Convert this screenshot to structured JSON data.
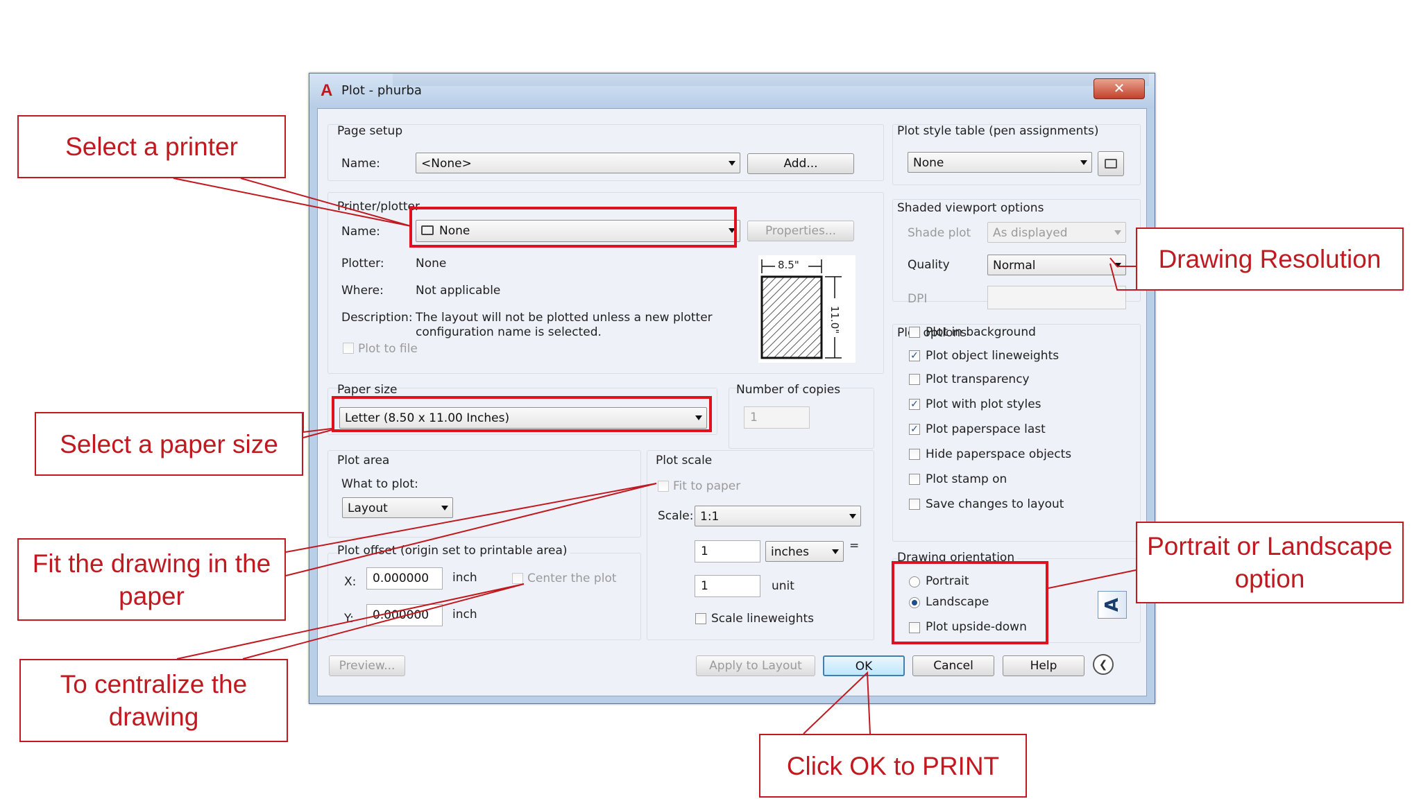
{
  "window": {
    "title": "Plot - phurba",
    "close_glyph": "✕"
  },
  "page_setup": {
    "group_label": "Page setup",
    "name_label": "Name:",
    "name_value": "<None>",
    "add_button": "Add..."
  },
  "printer": {
    "group_label": "Printer/plotter",
    "name_label": "Name:",
    "name_value": "None",
    "properties_button": "Properties...",
    "plotter_label": "Plotter:",
    "plotter_value": "None",
    "where_label": "Where:",
    "where_value": "Not applicable",
    "description_label": "Description:",
    "description_line1": "The layout will not be plotted unless a new plotter",
    "description_line2": "configuration name is selected.",
    "plot_to_file": "Plot to file",
    "preview_width": "8.5\"",
    "preview_height": "11.0\""
  },
  "paper_size": {
    "group_label": "Paper size",
    "value": "Letter (8.50 x 11.00 Inches)"
  },
  "copies": {
    "group_label": "Number of copies",
    "value": "1"
  },
  "plot_area": {
    "group_label": "Plot area",
    "what_label": "What to plot:",
    "what_value": "Layout"
  },
  "plot_offset": {
    "group_label": "Plot offset (origin set to printable area)",
    "x_label": "X:",
    "x_value": "0.000000",
    "x_unit": "inch",
    "y_label": "Y:",
    "y_value": "0.000000",
    "y_unit": "inch",
    "center": "Center the plot"
  },
  "plot_scale": {
    "group_label": "Plot scale",
    "fit": "Fit to paper",
    "scale_label": "Scale:",
    "scale_value": "1:1",
    "num_value": "1",
    "unit_select": "inches",
    "equals": "=",
    "den_value": "1",
    "den_unit": "unit",
    "scale_lineweights": "Scale lineweights"
  },
  "plot_style": {
    "group_label": "Plot style table (pen assignments)",
    "value": "None"
  },
  "shaded": {
    "group_label": "Shaded viewport options",
    "shade_label": "Shade plot",
    "shade_value": "As displayed",
    "quality_label": "Quality",
    "quality_value": "Normal",
    "dpi_label": "DPI"
  },
  "plot_options": {
    "group_label": "Plot options",
    "items": [
      {
        "label": "Plot in background",
        "checked": false
      },
      {
        "label": "Plot object lineweights",
        "checked": true
      },
      {
        "label": "Plot transparency",
        "checked": false
      },
      {
        "label": "Plot with plot styles",
        "checked": true
      },
      {
        "label": "Plot paperspace last",
        "checked": true
      },
      {
        "label": "Hide paperspace objects",
        "checked": false
      },
      {
        "label": "Plot stamp on",
        "checked": false
      },
      {
        "label": "Save changes to layout",
        "checked": false
      }
    ]
  },
  "orientation": {
    "group_label": "Drawing orientation",
    "portrait": "Portrait",
    "landscape": "Landscape",
    "upside_down": "Plot upside-down",
    "orientation_glyph": "A"
  },
  "buttons": {
    "preview": "Preview...",
    "apply": "Apply to Layout",
    "ok": "OK",
    "cancel": "Cancel",
    "help": "Help",
    "more_glyph": "❮"
  },
  "callouts": {
    "printer": "Select a printer",
    "paper": "Select a paper size",
    "fit_line1": "Fit the drawing in the",
    "fit_line2": "paper",
    "center_line1": "To centralize the",
    "center_line2": "drawing",
    "resolution": "Drawing Resolution",
    "orient_line1": "Portrait or Landscape",
    "orient_line2": "option",
    "ok": "Click OK to PRINT"
  },
  "colors": {
    "callout_red": "#c0191f",
    "highlight_red": "#e0111e",
    "dialog_bg": "#eef2f8"
  }
}
